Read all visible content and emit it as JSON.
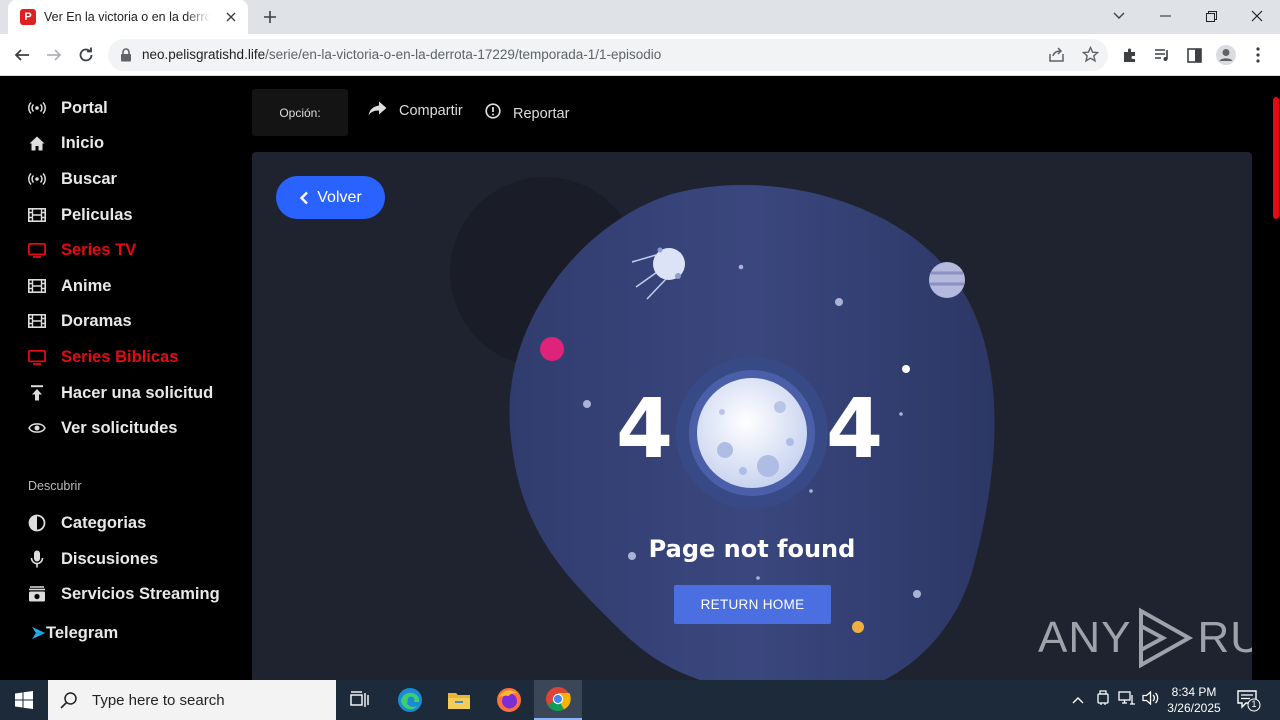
{
  "browser": {
    "tab_title": "Ver En la victoria o en la derrota",
    "favicon_letter": "P",
    "url_host": "neo.pelisgratishd.life",
    "url_path": "/serie/en-la-victoria-o-en-la-derrota-17229/temporada-1/1-episodio"
  },
  "sidebar": {
    "items": [
      {
        "label": "Portal",
        "icon": "broadcast-icon",
        "highlight": false
      },
      {
        "label": "Inicio",
        "icon": "home-icon",
        "highlight": false
      },
      {
        "label": "Buscar",
        "icon": "broadcast-icon",
        "highlight": false
      },
      {
        "label": "Peliculas",
        "icon": "film-icon",
        "highlight": false
      },
      {
        "label": "Series TV",
        "icon": "tv-icon",
        "highlight": true
      },
      {
        "label": "Anime",
        "icon": "film-icon",
        "highlight": false
      },
      {
        "label": "Doramas",
        "icon": "film-icon",
        "highlight": false
      },
      {
        "label": "Series Biblicas",
        "icon": "tv-icon",
        "highlight": true
      },
      {
        "label": "Hacer una solicitud",
        "icon": "upload-icon",
        "highlight": false
      },
      {
        "label": "Ver solicitudes",
        "icon": "eye-icon",
        "highlight": false
      }
    ],
    "section_title": "Descubrir",
    "discover_items": [
      {
        "label": "Categorias",
        "icon": "half-circle-icon"
      },
      {
        "label": "Discusiones",
        "icon": "microphone-icon"
      },
      {
        "label": "Servicios Streaming",
        "icon": "streaming-icon"
      },
      {
        "label": "Telegram",
        "icon": "telegram-icon"
      }
    ]
  },
  "player_bar": {
    "option_label": "Opción:",
    "share_label": "Compartir",
    "report_label": "Reportar"
  },
  "error_page": {
    "back_label": "Volver",
    "digit_left": "4",
    "digit_right": "4",
    "message": "Page not found",
    "button_label": "RETURN HOME"
  },
  "watermark": {
    "left": "ANY",
    "right": "RUN"
  },
  "taskbar": {
    "search_placeholder": "Type here to search",
    "time": "8:34 PM",
    "date": "3/26/2025",
    "notification_count": "1"
  },
  "colors": {
    "accent_red": "#e50914",
    "back_button": "#2962ff",
    "return_button": "#4b6fe0",
    "panel": "#1f2330"
  }
}
